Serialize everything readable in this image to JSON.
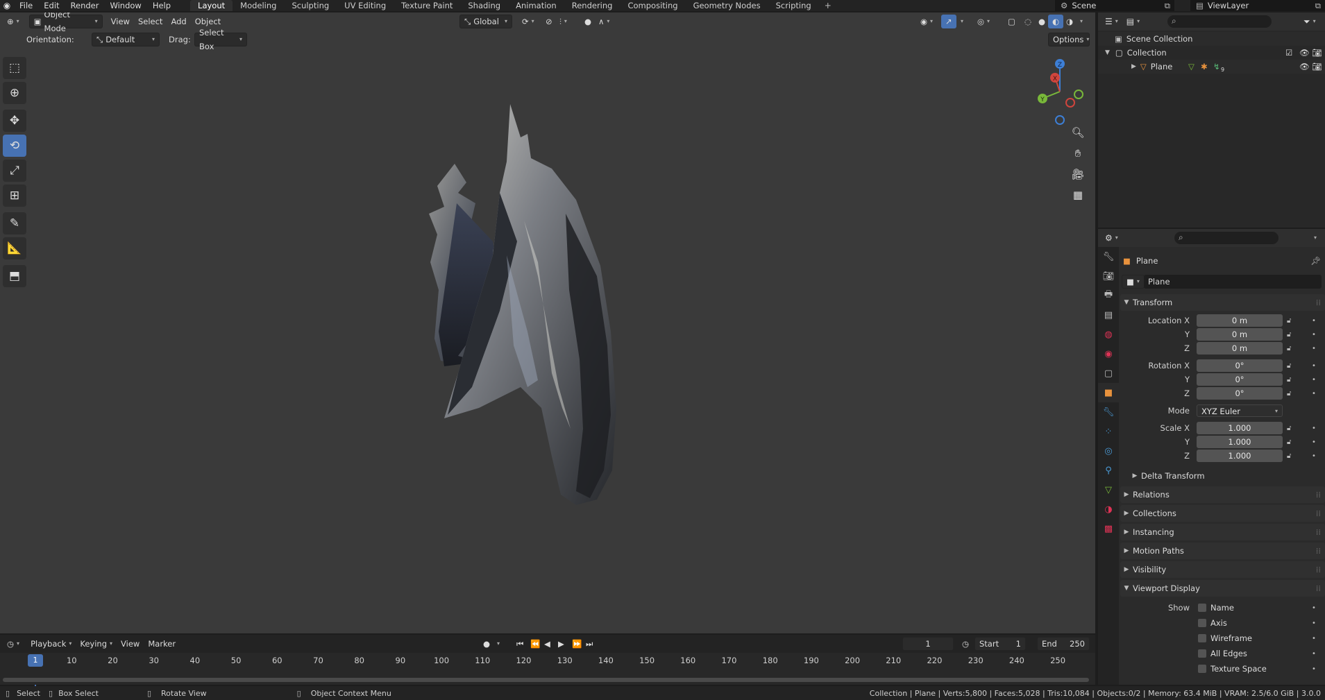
{
  "menu": [
    "File",
    "Edit",
    "Render",
    "Window",
    "Help"
  ],
  "workspaces": [
    "Layout",
    "Modeling",
    "Sculpting",
    "UV Editing",
    "Texture Paint",
    "Shading",
    "Animation",
    "Rendering",
    "Compositing",
    "Geometry Nodes",
    "Scripting"
  ],
  "scene": "Scene",
  "view_layer": "ViewLayer",
  "viewport": {
    "mode": "Object Mode",
    "menus": [
      "View",
      "Select",
      "Add",
      "Object"
    ],
    "transform_orientation": "Global",
    "orientation_label": "Orientation:",
    "orientation_value": "Default",
    "drag_label": "Drag:",
    "drag_value": "Select Box",
    "options": "Options",
    "gizmo_axes": [
      "Z",
      "Y",
      "X"
    ]
  },
  "timeline": {
    "menus": [
      "Playback",
      "Keying",
      "View",
      "Marker"
    ],
    "current_frame": "1",
    "start_label": "Start",
    "start_value": "1",
    "end_label": "End",
    "end_value": "250",
    "ticks": [
      "10",
      "20",
      "30",
      "40",
      "50",
      "60",
      "70",
      "80",
      "90",
      "100",
      "110",
      "120",
      "130",
      "140",
      "150",
      "160",
      "170",
      "180",
      "190",
      "200",
      "210",
      "220",
      "230",
      "240",
      "250"
    ],
    "marker_frame": "1"
  },
  "outliner": {
    "scene_collection": "Scene Collection",
    "collection": "Collection",
    "object": "Plane",
    "modifier_count": "9"
  },
  "properties": {
    "object_name": "Plane",
    "data_name": "Plane",
    "transform_title": "Transform",
    "location_label": "Location X",
    "rotation_label": "Rotation X",
    "scale_label": "Scale X",
    "axis_y": "Y",
    "axis_z": "Z",
    "location": [
      "0 m",
      "0 m",
      "0 m"
    ],
    "rotation": [
      "0°",
      "0°",
      "0°"
    ],
    "mode_label": "Mode",
    "mode_value": "XYZ Euler",
    "scale": [
      "1.000",
      "1.000",
      "1.000"
    ],
    "delta_transform": "Delta Transform",
    "panels": [
      "Relations",
      "Collections",
      "Instancing",
      "Motion Paths",
      "Visibility"
    ],
    "viewport_display": "Viewport Display",
    "show_label": "Show",
    "show_options": [
      "Name",
      "Axis",
      "Wireframe",
      "All Edges",
      "Texture Space"
    ]
  },
  "statusbar": {
    "select": "Select",
    "box_select": "Box Select",
    "rotate_view": "Rotate View",
    "context_menu": "Object Context Menu",
    "stats": "Collection | Plane | Verts:5,800 | Faces:5,028 | Tris:10,084 | Objects:0/2 | Memory: 63.4 MiB | VRAM: 2.5/6.0 GiB | 3.0.0"
  },
  "colors": {
    "accent": "#4772b3",
    "viewport_bg": "#3a3a3a",
    "panel_bg": "#2b2b2b",
    "axis_x": "#d0453d",
    "axis_y": "#79b83a",
    "axis_z": "#3d7fd6"
  }
}
